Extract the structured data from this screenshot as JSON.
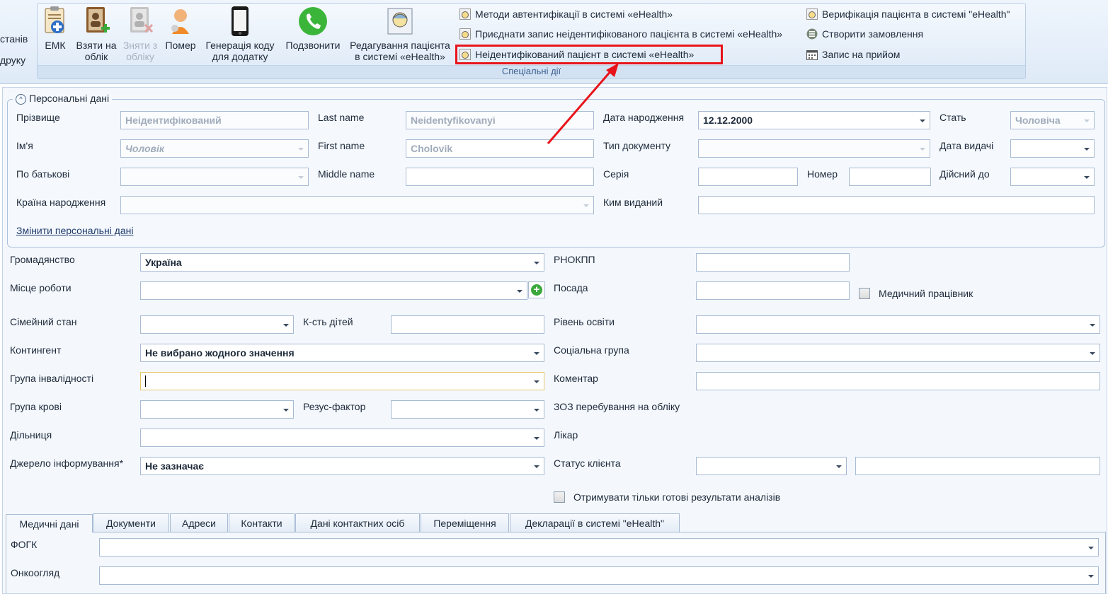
{
  "ribbon": {
    "left_partial": {
      "line1": "станів",
      "line2": "друку"
    },
    "buttons": [
      {
        "id": "emk",
        "line1": "ЕМК",
        "line2": ""
      },
      {
        "id": "take",
        "line1": "Взяти на",
        "line2": "облік"
      },
      {
        "id": "remove",
        "line1": "Зняти з",
        "line2": "обліку"
      },
      {
        "id": "died",
        "line1": "Помер",
        "line2": ""
      },
      {
        "id": "gencode",
        "line1": "Генерація коду",
        "line2": "для додатку"
      },
      {
        "id": "call",
        "line1": "Подзвонити",
        "line2": ""
      },
      {
        "id": "editpatient",
        "line1": "Редагування пацієнта",
        "line2": "в системі «eHealth»"
      }
    ],
    "small_items": {
      "auth_methods": "Методи автентифікації в системі «eHealth»",
      "attach_record": "Приєднати запис неідентифікованого пацієнта в системі «eHealth»",
      "unidentified": "Неідентифікований пацієнт в системі «eHealth»",
      "verify": "Верифікація пацієнта в системі \"eHealth\"",
      "create_order": "Створити замовлення",
      "appointment": "Запис на прийом"
    },
    "group_title": "Спеціальні дії"
  },
  "personal": {
    "title": "Персональні дані",
    "labels": {
      "surname": "Прізвище",
      "name": "Ім'я",
      "patronymic": "По батькові",
      "country": "Країна народження",
      "last_name": "Last name",
      "first_name": "First name",
      "middle_name": "Middle name",
      "birth_date": "Дата народження",
      "doc_type": "Тип документу",
      "series": "Серія",
      "number": "Номер",
      "issued_by": "Ким виданий",
      "sex": "Стать",
      "issue_date": "Дата видачі",
      "valid_until": "Дійсний до"
    },
    "values": {
      "surname": "Неідентифікований",
      "name": "Чоловік",
      "last_name": "Neidentyfikovanyi",
      "first_name": "Cholovik",
      "birth_date": "12.12.2000",
      "sex": "Чоловіча"
    },
    "change_link": "Змінити персональні дані"
  },
  "main": {
    "labels": {
      "citizenship": "Громадянство",
      "workplace": "Місце роботи",
      "marital": "Сімейний стан",
      "children": "К-сть дітей",
      "contingent": "Контингент",
      "disability": "Група інвалідності",
      "blood": "Група крові",
      "rh": "Резус-фактор",
      "district": "Дільниця",
      "info_source": "Джерело інформування*",
      "rnokpp": "РНОКПП",
      "position": "Посада",
      "medical_worker": "Медичний працівник",
      "education": "Рівень освіти",
      "social_group": "Соціальна група",
      "comment": "Коментар",
      "zoz": "ЗОЗ перебування на обліку",
      "doctor": "Лікар",
      "client_status": "Статус клієнта",
      "ready_results": "Отримувати тільки готові результати аналізів"
    },
    "values": {
      "citizenship": "Україна",
      "contingent": "Не вибрано жодного значення",
      "info_source": "Не зазначає"
    }
  },
  "tabs": [
    "Медичні дані",
    "Документи",
    "Адреси",
    "Контакти",
    "Дані контактних осіб",
    "Переміщення",
    "Декларації в системі \"eHealth\""
  ],
  "tab_body": {
    "fogk": "ФОГК",
    "onco": "Онкоогляд"
  },
  "colors": {
    "highlight": "#e8141b",
    "accent_border": "#a8bbd3",
    "link": "#1e3a6a"
  }
}
